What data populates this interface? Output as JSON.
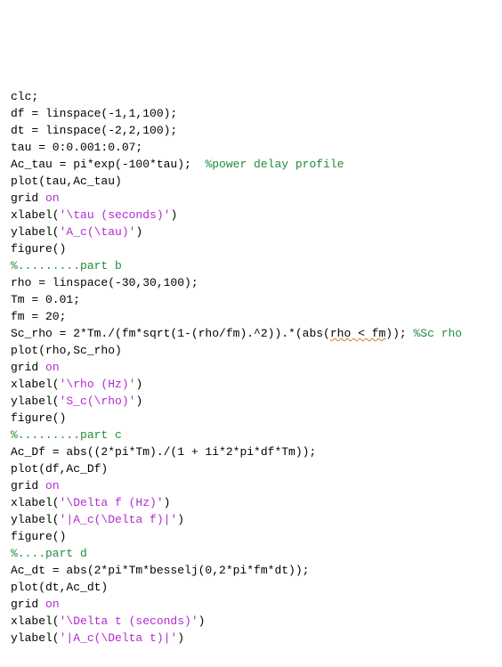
{
  "lines": [
    {
      "segments": [
        {
          "t": "clc;",
          "c": "k"
        }
      ]
    },
    {
      "segments": [
        {
          "t": "df = linspace(-1,1,100);",
          "c": "k"
        }
      ]
    },
    {
      "segments": [
        {
          "t": "dt = linspace(-2,2,100);",
          "c": "k"
        }
      ]
    },
    {
      "segments": [
        {
          "t": "tau = 0:0.001:0.07;",
          "c": "k"
        }
      ]
    },
    {
      "segments": [
        {
          "t": "Ac_tau = pi*exp(-100*tau);  ",
          "c": "k"
        },
        {
          "t": "%power delay profile",
          "c": "g"
        }
      ]
    },
    {
      "segments": [
        {
          "t": "plot(tau,Ac_tau)",
          "c": "k"
        }
      ]
    },
    {
      "segments": [
        {
          "t": "grid ",
          "c": "k"
        },
        {
          "t": "on",
          "c": "p"
        }
      ]
    },
    {
      "segments": [
        {
          "t": "xlabel(",
          "c": "k"
        },
        {
          "t": "'\\tau (seconds)'",
          "c": "p"
        },
        {
          "t": ")",
          "c": "k"
        }
      ]
    },
    {
      "segments": [
        {
          "t": "ylabel(",
          "c": "k"
        },
        {
          "t": "'A_c(\\tau)'",
          "c": "p"
        },
        {
          "t": ")",
          "c": "k"
        }
      ]
    },
    {
      "segments": [
        {
          "t": "figure()",
          "c": "k"
        }
      ]
    },
    {
      "segments": [
        {
          "t": "%.........part b",
          "c": "g"
        }
      ]
    },
    {
      "segments": [
        {
          "t": "rho = linspace(-30,30,100);",
          "c": "k"
        }
      ]
    },
    {
      "segments": [
        {
          "t": "Tm = 0.01;",
          "c": "k"
        }
      ]
    },
    {
      "segments": [
        {
          "t": "fm = 20;",
          "c": "k"
        }
      ]
    },
    {
      "segments": [
        {
          "t": "Sc_rho = 2*Tm./(fm*sqrt(1-(rho/fm).^2)).*(abs(",
          "c": "k"
        },
        {
          "t": "rho < fm",
          "c": "k",
          "wavy": true
        },
        {
          "t": ")); ",
          "c": "k"
        },
        {
          "t": "%Sc rho",
          "c": "g"
        }
      ]
    },
    {
      "segments": [
        {
          "t": "plot(rho,Sc_rho)",
          "c": "k"
        }
      ]
    },
    {
      "segments": [
        {
          "t": "grid ",
          "c": "k"
        },
        {
          "t": "on",
          "c": "p"
        }
      ]
    },
    {
      "segments": [
        {
          "t": "xlabel(",
          "c": "k"
        },
        {
          "t": "'\\rho (Hz)'",
          "c": "p"
        },
        {
          "t": ")",
          "c": "k"
        }
      ]
    },
    {
      "segments": [
        {
          "t": "ylabel(",
          "c": "k"
        },
        {
          "t": "'S_c(\\rho)'",
          "c": "p"
        },
        {
          "t": ")",
          "c": "k"
        }
      ]
    },
    {
      "segments": [
        {
          "t": "figure()",
          "c": "k"
        }
      ]
    },
    {
      "segments": [
        {
          "t": "%.........part c",
          "c": "g"
        }
      ]
    },
    {
      "segments": [
        {
          "t": "Ac_Df = abs((2*pi*Tm)./(1 + 1i*2*pi*df*Tm));",
          "c": "k"
        }
      ]
    },
    {
      "segments": [
        {
          "t": "plot(df,Ac_Df)",
          "c": "k"
        }
      ]
    },
    {
      "segments": [
        {
          "t": "grid ",
          "c": "k"
        },
        {
          "t": "on",
          "c": "p"
        }
      ]
    },
    {
      "segments": [
        {
          "t": "xlabel(",
          "c": "k"
        },
        {
          "t": "'\\Delta f (Hz)'",
          "c": "p"
        },
        {
          "t": ")",
          "c": "k"
        }
      ]
    },
    {
      "segments": [
        {
          "t": "ylabel(",
          "c": "k"
        },
        {
          "t": "'|A_c(\\Delta f)|'",
          "c": "p"
        },
        {
          "t": ")",
          "c": "k"
        }
      ]
    },
    {
      "segments": [
        {
          "t": "figure()",
          "c": "k"
        }
      ]
    },
    {
      "segments": [
        {
          "t": "%....part d",
          "c": "g"
        }
      ]
    },
    {
      "segments": [
        {
          "t": "Ac_dt = abs(2*pi*Tm*besselj(0,2*pi*fm*dt));",
          "c": "k"
        }
      ]
    },
    {
      "segments": [
        {
          "t": "plot(dt,Ac_dt)",
          "c": "k"
        }
      ]
    },
    {
      "segments": [
        {
          "t": "grid ",
          "c": "k"
        },
        {
          "t": "on",
          "c": "p"
        }
      ]
    },
    {
      "segments": [
        {
          "t": "xlabel(",
          "c": "k"
        },
        {
          "t": "'\\Delta t (seconds)'",
          "c": "p"
        },
        {
          "t": ")",
          "c": "k"
        }
      ]
    },
    {
      "segments": [
        {
          "t": "ylabel(",
          "c": "k"
        },
        {
          "t": "'|A_c(\\Delta t)|'",
          "c": "p"
        },
        {
          "t": ")",
          "c": "k"
        }
      ]
    }
  ]
}
